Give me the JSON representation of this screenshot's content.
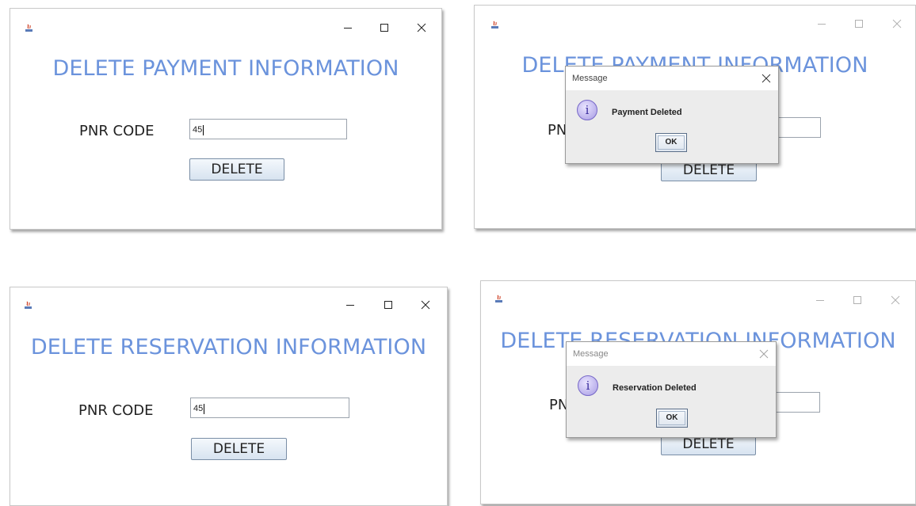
{
  "payment_window": {
    "title": "DELETE PAYMENT INFORMATION",
    "pnr_label": "PNR CODE",
    "pnr_value": "45",
    "delete_label": "DELETE"
  },
  "payment_window_dialog": {
    "title": "DELETE PAYMENT INFORMATION",
    "pnr_label_visible": "PN",
    "delete_label": "DELETE",
    "dialog": {
      "title": "Message",
      "message": "Payment Deleted",
      "ok_label": "OK",
      "icon": "info-icon"
    }
  },
  "reservation_window": {
    "title": "DELETE RESERVATION INFORMATION",
    "pnr_label": "PNR CODE",
    "pnr_value": "45",
    "delete_label": "DELETE"
  },
  "reservation_window_dialog": {
    "title": "DELETE RESERVATION INFORMATION",
    "pnr_label_visible": "PN",
    "delete_label": "DELETE",
    "dialog": {
      "title": "Message",
      "message": "Reservation Deleted",
      "ok_label": "OK",
      "icon": "info-icon"
    }
  },
  "window_controls": [
    "minimize-icon",
    "maximize-icon",
    "close-icon"
  ],
  "colors": {
    "title_blue": "#6b93dc",
    "button_gradient_top": "#f4f8fc",
    "button_gradient_bottom": "#d7e3f0",
    "dialog_bg": "#ececec"
  }
}
